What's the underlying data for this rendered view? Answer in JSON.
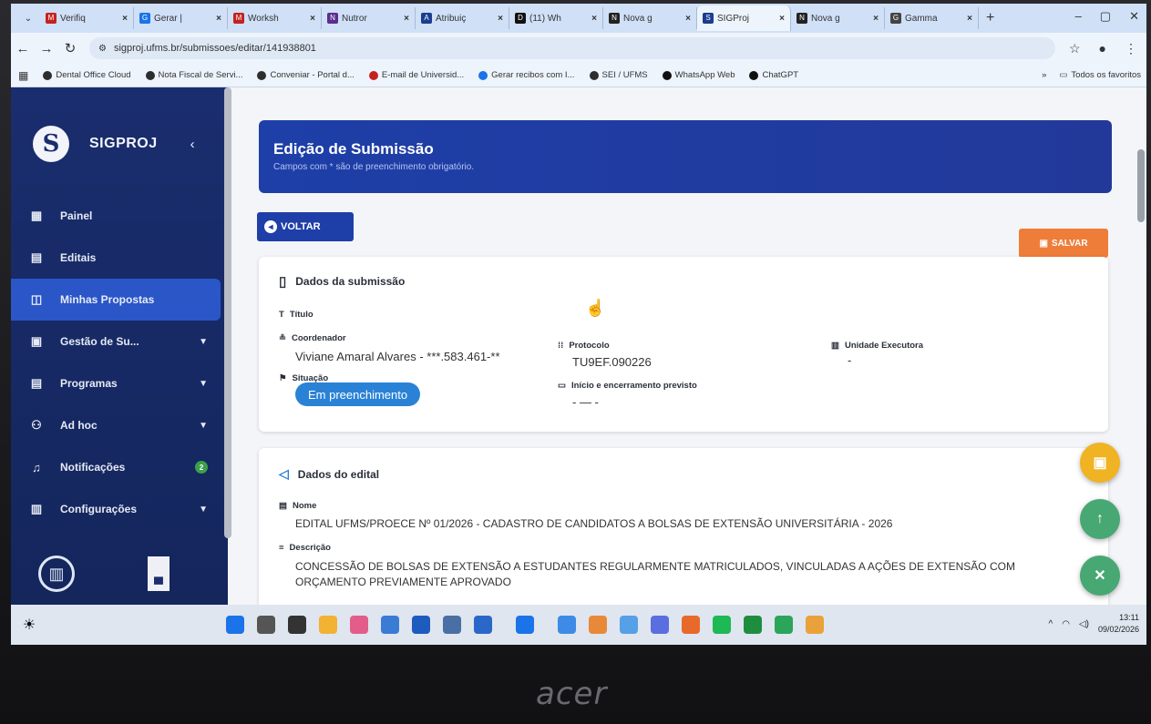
{
  "browser": {
    "tabs": [
      {
        "label": "Verifiq",
        "color": "#c5221f",
        "glyph": "M"
      },
      {
        "label": "Gerar |",
        "color": "#1a73e8",
        "glyph": "G"
      },
      {
        "label": "Worksh",
        "color": "#c5221f",
        "glyph": "M"
      },
      {
        "label": "Nutror",
        "color": "#5b2d8e",
        "glyph": "N"
      },
      {
        "label": "Atribuiç",
        "color": "#1a3d8f",
        "glyph": "A"
      },
      {
        "label": "(11) Wh",
        "color": "#111111",
        "glyph": "D"
      },
      {
        "label": "Nova g",
        "color": "#222222",
        "glyph": "N"
      },
      {
        "label": "SIGProj",
        "color": "#1a3d8f",
        "glyph": "S"
      },
      {
        "label": "Nova g",
        "color": "#222222",
        "glyph": "N"
      },
      {
        "label": "Gamma",
        "color": "#444444",
        "glyph": "G"
      }
    ],
    "active_tab_index": 7,
    "url": "sigproj.ufms.br/submissoes/editar/141938801",
    "bookmarks": [
      {
        "label": "Dental Office Cloud",
        "color": "#2d2d2d"
      },
      {
        "label": "Nota Fiscal de Servi...",
        "color": "#2d2d2d"
      },
      {
        "label": "Conveniar - Portal d...",
        "color": "#2d2d2d"
      },
      {
        "label": "E-mail de Universid...",
        "color": "#c5221f"
      },
      {
        "label": "Gerar recibos com I...",
        "color": "#1a73e8"
      },
      {
        "label": "SEI / UFMS",
        "color": "#2d2d2d"
      },
      {
        "label": "WhatsApp Web",
        "color": "#111111"
      },
      {
        "label": "ChatGPT",
        "color": "#111111"
      }
    ],
    "bookmarks_more": "»",
    "all_bookmarks": "Todos os favoritos"
  },
  "sidebar": {
    "brand": "SIGPROJ",
    "logo_glyph": "S",
    "collapse_glyph": "‹",
    "items": [
      {
        "label": "Painel",
        "icon": "dashboard-icon",
        "glyph": "▦",
        "chevron": false
      },
      {
        "label": "Editais",
        "icon": "document-icon",
        "glyph": "▤",
        "chevron": false
      },
      {
        "label": "Minhas Propostas",
        "icon": "proposal-icon",
        "glyph": "◫",
        "chevron": false,
        "active": true
      },
      {
        "label": "Gestão de Su...",
        "icon": "file-icon",
        "glyph": "▣",
        "chevron": true
      },
      {
        "label": "Programas",
        "icon": "list-icon",
        "glyph": "▤",
        "chevron": true
      },
      {
        "label": "Ad hoc",
        "icon": "people-icon",
        "glyph": "⚇",
        "chevron": true
      },
      {
        "label": "Notificações",
        "icon": "bell-icon",
        "glyph": "♫",
        "chevron": false,
        "badge": "2"
      },
      {
        "label": "Configurações",
        "icon": "settings-icon",
        "glyph": "▥",
        "chevron": true
      }
    ]
  },
  "page": {
    "title": "Edição de Submissão",
    "subtitle": "Campos com * são de preenchimento obrigatório.",
    "back_label": "VOLTAR",
    "save_label": "SALVAR"
  },
  "submission": {
    "section_title": "Dados da submissão",
    "titulo_label": "Título",
    "coordenador_label": "Coordenador",
    "coordenador_value": "Viviane Amaral Alvares - ***.583.461-**",
    "situacao_label": "Situação",
    "situacao_value": "Em preenchimento",
    "protocolo_label": "Protocolo",
    "protocolo_value": "TU9EF.090226",
    "inicio_label": "Início e encerramento previsto",
    "inicio_value": "- — -",
    "unidade_label": "Unidade Executora",
    "unidade_value": "-"
  },
  "edital": {
    "section_title": "Dados do edital",
    "nome_label": "Nome",
    "nome_value": "EDITAL UFMS/PROECE Nº 01/2026 - CADASTRO DE CANDIDATOS A BOLSAS DE EXTENSÃO UNIVERSITÁRIA - 2026",
    "descricao_label": "Descrição",
    "descricao_value": "CONCESSÃO DE BOLSAS DE EXTENSÃO A ESTUDANTES REGULARMENTE MATRICULADOS, VINCULADAS A AÇÕES DE EXTENSÃO COM ORÇAMENTO PREVIAMENTE APROVADO"
  },
  "taskbar": {
    "time": "13:11",
    "date": "09/02/2026"
  },
  "device_brand": "acer"
}
